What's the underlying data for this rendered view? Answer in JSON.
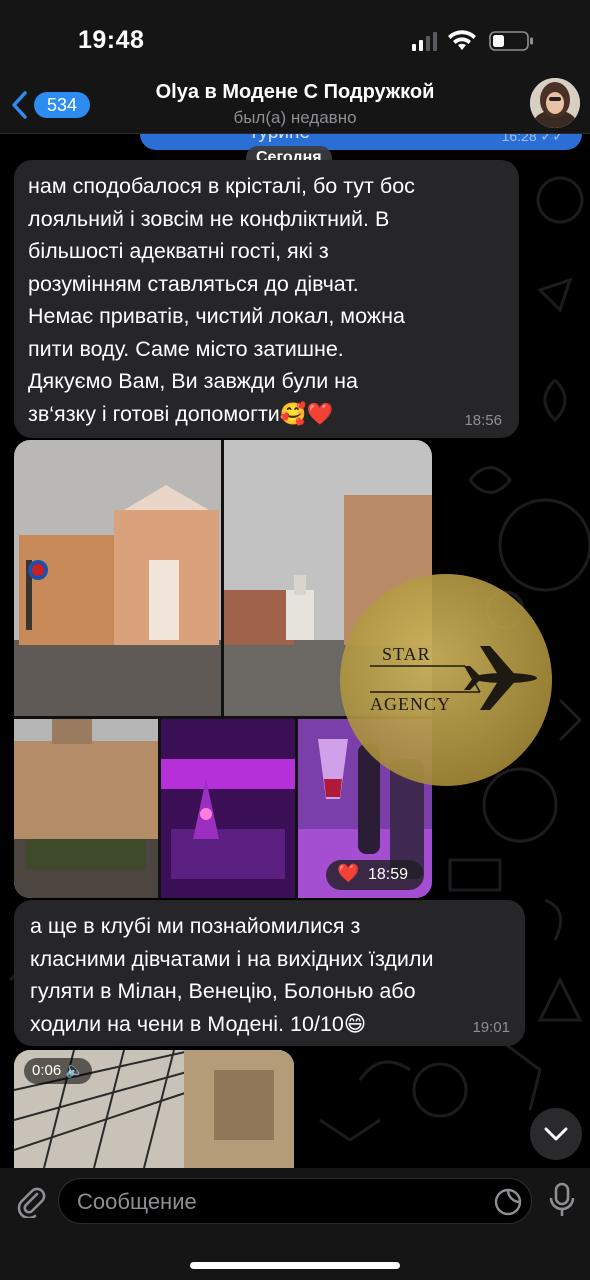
{
  "status_bar": {
    "time": "19:48"
  },
  "header": {
    "back_count": "534",
    "title": "Olya в Модене С Подружкой",
    "subtitle": "был(а) недавно"
  },
  "previous_message": {
    "text_fragment": "Турине",
    "time": "16:28"
  },
  "date_separator": "Сегодня",
  "messages": [
    {
      "text": "нам сподобалося в крісталі, бо тут бос\nлояльний і зовсім не конфліктний. В\nбільшості адекватні гості, які з\nрозумінням ставляться до дівчат.\nНемає приватів, чистий локал, можна\nпити воду. Саме місто затишне.\nДякуємо Вам, Ви завжди були на\nзв‘язку і готові допомогти🥰❤️",
      "time": "18:56"
    },
    {
      "text": "а ще в клубі ми познайомилися з\nкласними дівчатами і на вихідних їздили\nгуляти в Мілан, Венецію, Болонью або\nходили на чени в Модені. 10/10😄",
      "time": "19:01"
    }
  ],
  "album": {
    "reaction": "❤️",
    "time": "18:59"
  },
  "watermark": {
    "line1": "STAR",
    "line2": "AGENCY"
  },
  "video": {
    "duration": "0:06"
  },
  "composer": {
    "placeholder": "Сообщение"
  },
  "colors": {
    "accent": "#2d8cf0",
    "incoming_bubble": "#262628",
    "outgoing_bubble": "#2b6fd6",
    "reaction": "#e01e37"
  }
}
